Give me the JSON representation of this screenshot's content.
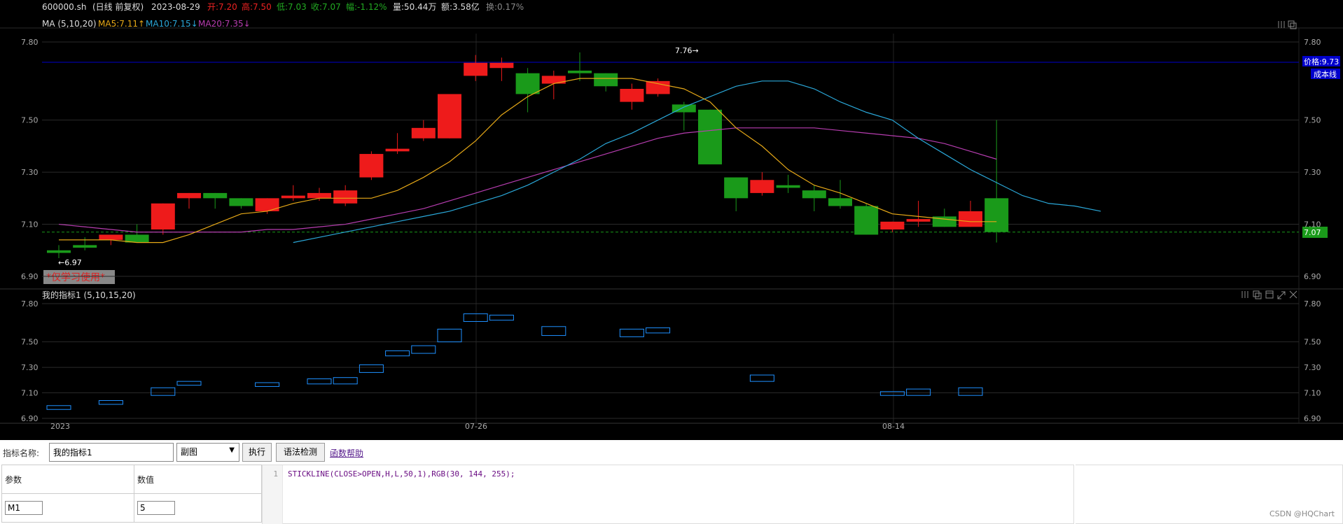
{
  "colors": {
    "up": "#ee1b1b",
    "down": "#1a9a1a",
    "ma5": "#e6a817",
    "ma10": "#2aa7d8",
    "ma20": "#b73db0",
    "box": "#1e90ff",
    "grid": "#2a2a2a",
    "axis": "#aaaaaa"
  },
  "header": {
    "symbol": "600000.sh",
    "period": "(日线 前复权)",
    "date": "2023-08-29",
    "open": "开:7.20",
    "high": "高:7.50",
    "low": "低:7.03",
    "close": "收:7.07",
    "change": "幅:-1.12%",
    "volume": "量:50.44万",
    "amount": "额:3.58亿",
    "turnover": "换:0.17%"
  },
  "ma_legend": {
    "label": "MA (5,10,20)",
    "ma5": "MA5:7.11↑",
    "ma10": "MA10:7.15↓",
    "ma20": "MA20:7.35↓"
  },
  "main_axis": {
    "ticks": [
      "7.80",
      "7.50",
      "7.30",
      "7.10",
      "6.90"
    ]
  },
  "sub_axis": {
    "ticks": [
      "7.80",
      "7.50",
      "7.30",
      "7.10",
      "6.90"
    ]
  },
  "annotations": {
    "max_label": "7.76→",
    "min_label": "←6.97",
    "watermark": "*仅学习使用*",
    "price_tag": "价格:9.73",
    "cost_tag": "成本线",
    "last_price": "7.07"
  },
  "sub_indicator": {
    "title": "我的指标1 (5,10,15,20)"
  },
  "x_axis": {
    "labels": [
      "2023",
      "07-26",
      "08-14"
    ]
  },
  "chart_data": {
    "type": "candlestick",
    "ylim": [
      6.9,
      7.8
    ],
    "candles": [
      {
        "o": 7.0,
        "h": 7.02,
        "l": 6.97,
        "c": 6.99
      },
      {
        "o": 7.02,
        "h": 7.05,
        "l": 7.0,
        "c": 7.01
      },
      {
        "o": 7.04,
        "h": 7.06,
        "l": 7.02,
        "c": 7.06
      },
      {
        "o": 7.06,
        "h": 7.1,
        "l": 7.04,
        "c": 7.03
      },
      {
        "o": 7.08,
        "h": 7.18,
        "l": 7.06,
        "c": 7.18
      },
      {
        "o": 7.2,
        "h": 7.22,
        "l": 7.16,
        "c": 7.22
      },
      {
        "o": 7.22,
        "h": 7.22,
        "l": 7.16,
        "c": 7.2
      },
      {
        "o": 7.2,
        "h": 7.2,
        "l": 7.16,
        "c": 7.17
      },
      {
        "o": 7.15,
        "h": 7.2,
        "l": 7.14,
        "c": 7.2
      },
      {
        "o": 7.2,
        "h": 7.25,
        "l": 7.19,
        "c": 7.21
      },
      {
        "o": 7.2,
        "h": 7.24,
        "l": 7.19,
        "c": 7.22
      },
      {
        "o": 7.18,
        "h": 7.25,
        "l": 7.17,
        "c": 7.23
      },
      {
        "o": 7.28,
        "h": 7.38,
        "l": 7.27,
        "c": 7.37
      },
      {
        "o": 7.38,
        "h": 7.45,
        "l": 7.37,
        "c": 7.39
      },
      {
        "o": 7.43,
        "h": 7.5,
        "l": 7.42,
        "c": 7.47
      },
      {
        "o": 7.43,
        "h": 7.6,
        "l": 7.43,
        "c": 7.6
      },
      {
        "o": 7.67,
        "h": 7.75,
        "l": 7.65,
        "c": 7.72
      },
      {
        "o": 7.7,
        "h": 7.74,
        "l": 7.65,
        "c": 7.72
      },
      {
        "o": 7.68,
        "h": 7.7,
        "l": 7.53,
        "c": 7.6
      },
      {
        "o": 7.64,
        "h": 7.69,
        "l": 7.58,
        "c": 7.67
      },
      {
        "o": 7.69,
        "h": 7.76,
        "l": 7.65,
        "c": 7.68
      },
      {
        "o": 7.68,
        "h": 7.68,
        "l": 7.61,
        "c": 7.63
      },
      {
        "o": 7.57,
        "h": 7.64,
        "l": 7.54,
        "c": 7.62
      },
      {
        "o": 7.6,
        "h": 7.66,
        "l": 7.59,
        "c": 7.65
      },
      {
        "o": 7.56,
        "h": 7.57,
        "l": 7.46,
        "c": 7.53
      },
      {
        "o": 7.54,
        "h": 7.54,
        "l": 7.33,
        "c": 7.33
      },
      {
        "o": 7.28,
        "h": 7.28,
        "l": 7.15,
        "c": 7.2
      },
      {
        "o": 7.22,
        "h": 7.3,
        "l": 7.21,
        "c": 7.27
      },
      {
        "o": 7.25,
        "h": 7.29,
        "l": 7.22,
        "c": 7.24
      },
      {
        "o": 7.23,
        "h": 7.25,
        "l": 7.15,
        "c": 7.2
      },
      {
        "o": 7.2,
        "h": 7.27,
        "l": 7.16,
        "c": 7.17
      },
      {
        "o": 7.17,
        "h": 7.18,
        "l": 7.06,
        "c": 7.06
      },
      {
        "o": 7.08,
        "h": 7.11,
        "l": 7.07,
        "c": 7.11
      },
      {
        "o": 7.11,
        "h": 7.19,
        "l": 7.09,
        "c": 7.12
      },
      {
        "o": 7.13,
        "h": 7.16,
        "l": 7.09,
        "c": 7.09
      },
      {
        "o": 7.09,
        "h": 7.19,
        "l": 7.09,
        "c": 7.15
      },
      {
        "o": 7.2,
        "h": 7.5,
        "l": 7.03,
        "c": 7.07
      }
    ],
    "ma5": [
      7.04,
      7.04,
      7.04,
      7.03,
      7.03,
      7.06,
      7.1,
      7.14,
      7.15,
      7.18,
      7.2,
      7.2,
      7.2,
      7.23,
      7.28,
      7.34,
      7.42,
      7.52,
      7.59,
      7.64,
      7.66,
      7.66,
      7.66,
      7.64,
      7.62,
      7.57,
      7.47,
      7.4,
      7.31,
      7.25,
      7.22,
      7.18,
      7.14,
      7.13,
      7.12,
      7.11,
      7.11
    ],
    "ma10": [
      null,
      null,
      null,
      null,
      null,
      null,
      null,
      null,
      null,
      7.03,
      7.05,
      7.07,
      7.09,
      7.11,
      7.13,
      7.15,
      7.18,
      7.21,
      7.25,
      7.3,
      7.35,
      7.41,
      7.45,
      7.5,
      7.55,
      7.59,
      7.63,
      7.65,
      7.65,
      7.62,
      7.57,
      7.53,
      7.5,
      7.43,
      7.37,
      7.31,
      7.26,
      7.21,
      7.18,
      7.17,
      7.15
    ],
    "ma20": [
      7.1,
      7.09,
      7.08,
      7.07,
      7.07,
      7.07,
      7.07,
      7.07,
      7.08,
      7.08,
      7.09,
      7.1,
      7.12,
      7.14,
      7.16,
      7.19,
      7.22,
      7.25,
      7.28,
      7.31,
      7.34,
      7.37,
      7.4,
      7.43,
      7.45,
      7.46,
      7.47,
      7.47,
      7.47,
      7.47,
      7.46,
      7.45,
      7.44,
      7.43,
      7.41,
      7.38,
      7.35
    ],
    "sub_boxes": [
      {
        "i": 0,
        "lo": 6.97,
        "hi": 7.0
      },
      {
        "i": 2,
        "lo": 7.01,
        "hi": 7.04
      },
      {
        "i": 4,
        "lo": 7.08,
        "hi": 7.14
      },
      {
        "i": 5,
        "lo": 7.16,
        "hi": 7.19
      },
      {
        "i": 8,
        "lo": 7.15,
        "hi": 7.18
      },
      {
        "i": 10,
        "lo": 7.17,
        "hi": 7.21
      },
      {
        "i": 11,
        "lo": 7.17,
        "hi": 7.22
      },
      {
        "i": 12,
        "lo": 7.26,
        "hi": 7.32
      },
      {
        "i": 13,
        "lo": 7.39,
        "hi": 7.43
      },
      {
        "i": 14,
        "lo": 7.41,
        "hi": 7.47
      },
      {
        "i": 15,
        "lo": 7.5,
        "hi": 7.6
      },
      {
        "i": 16,
        "lo": 7.66,
        "hi": 7.72
      },
      {
        "i": 17,
        "lo": 7.67,
        "hi": 7.71
      },
      {
        "i": 19,
        "lo": 7.55,
        "hi": 7.62
      },
      {
        "i": 22,
        "lo": 7.54,
        "hi": 7.6
      },
      {
        "i": 23,
        "lo": 7.57,
        "hi": 7.61
      },
      {
        "i": 27,
        "lo": 7.19,
        "hi": 7.24
      },
      {
        "i": 32,
        "lo": 7.08,
        "hi": 7.11
      },
      {
        "i": 33,
        "lo": 7.08,
        "hi": 7.13
      },
      {
        "i": 35,
        "lo": 7.08,
        "hi": 7.14
      }
    ]
  },
  "editor": {
    "name_label": "指标名称:",
    "name_value": "我的指标1",
    "type_options": [
      "副图"
    ],
    "execute_button": "执行",
    "syntax_button": "语法检测",
    "help_link": "函数帮助",
    "param_header": "参数",
    "value_header": "数值",
    "params": [
      {
        "name": "M1",
        "value": "5"
      }
    ],
    "line_no": "1",
    "code": "STICKLINE(CLOSE>OPEN,H,L,50,1),RGB(30, 144, 255);"
  },
  "footer": {
    "credit": "CSDN @HQChart"
  }
}
